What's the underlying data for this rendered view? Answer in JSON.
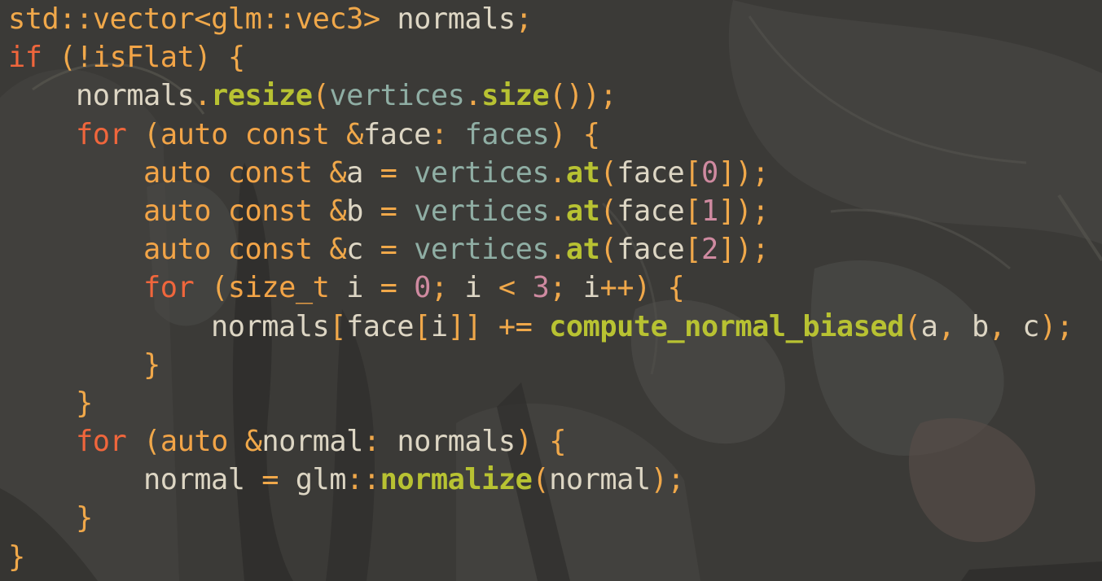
{
  "editor": {
    "language": "C++",
    "background_color": "#3b3a37",
    "theme": {
      "plain": "#ddd6c4",
      "punctuation": "#f0a84a",
      "keyword": "#f2a447",
      "control_flow": "#f0663c",
      "function": "#b8c232",
      "variable_dim": "#8faea4",
      "number": "#cf8aa0"
    }
  },
  "code": {
    "lines": [
      [
        [
          "ty",
          "std"
        ],
        [
          "pn",
          "::"
        ],
        [
          "ty",
          "vector"
        ],
        [
          "pn",
          "<"
        ],
        [
          "ty",
          "glm"
        ],
        [
          "pn",
          "::"
        ],
        [
          "ty",
          "vec3"
        ],
        [
          "pn",
          "> "
        ],
        [
          "pl",
          "normals"
        ],
        [
          "pn",
          ";"
        ]
      ],
      [
        [
          "cf",
          "if"
        ],
        [
          "pl",
          " "
        ],
        [
          "pn",
          "(!"
        ],
        [
          "kw",
          "isFlat"
        ],
        [
          "pn",
          ")"
        ],
        [
          "pl",
          " "
        ],
        [
          "pn",
          "{"
        ]
      ],
      [
        [
          "pl",
          "    normals"
        ],
        [
          "pn",
          "."
        ],
        [
          "fn",
          "resize"
        ],
        [
          "pn",
          "("
        ],
        [
          "vr",
          "vertices"
        ],
        [
          "pn",
          "."
        ],
        [
          "fn",
          "size"
        ],
        [
          "pn",
          "());"
        ]
      ],
      [
        [
          "pl",
          "    "
        ],
        [
          "cf",
          "for"
        ],
        [
          "pl",
          " "
        ],
        [
          "pn",
          "("
        ],
        [
          "kw",
          "auto"
        ],
        [
          "pl",
          " "
        ],
        [
          "kw",
          "const"
        ],
        [
          "pl",
          " "
        ],
        [
          "pn",
          "&"
        ],
        [
          "pl",
          "face"
        ],
        [
          "pn",
          ":"
        ],
        [
          "pl",
          " "
        ],
        [
          "vr",
          "faces"
        ],
        [
          "pn",
          ")"
        ],
        [
          "pl",
          " "
        ],
        [
          "pn",
          "{"
        ]
      ],
      [
        [
          "pl",
          "        "
        ],
        [
          "kw",
          "auto"
        ],
        [
          "pl",
          " "
        ],
        [
          "kw",
          "const"
        ],
        [
          "pl",
          " "
        ],
        [
          "pn",
          "&"
        ],
        [
          "pl",
          "a "
        ],
        [
          "op",
          "="
        ],
        [
          "pl",
          " "
        ],
        [
          "vr",
          "vertices"
        ],
        [
          "pn",
          "."
        ],
        [
          "fn",
          "at"
        ],
        [
          "pn",
          "("
        ],
        [
          "pl",
          "face"
        ],
        [
          "pn",
          "["
        ],
        [
          "nm",
          "0"
        ],
        [
          "pn",
          "]);"
        ]
      ],
      [
        [
          "pl",
          "        "
        ],
        [
          "kw",
          "auto"
        ],
        [
          "pl",
          " "
        ],
        [
          "kw",
          "const"
        ],
        [
          "pl",
          " "
        ],
        [
          "pn",
          "&"
        ],
        [
          "pl",
          "b "
        ],
        [
          "op",
          "="
        ],
        [
          "pl",
          " "
        ],
        [
          "vr",
          "vertices"
        ],
        [
          "pn",
          "."
        ],
        [
          "fn",
          "at"
        ],
        [
          "pn",
          "("
        ],
        [
          "pl",
          "face"
        ],
        [
          "pn",
          "["
        ],
        [
          "nm",
          "1"
        ],
        [
          "pn",
          "]);"
        ]
      ],
      [
        [
          "pl",
          "        "
        ],
        [
          "kw",
          "auto"
        ],
        [
          "pl",
          " "
        ],
        [
          "kw",
          "const"
        ],
        [
          "pl",
          " "
        ],
        [
          "pn",
          "&"
        ],
        [
          "pl",
          "c "
        ],
        [
          "op",
          "="
        ],
        [
          "pl",
          " "
        ],
        [
          "vr",
          "vertices"
        ],
        [
          "pn",
          "."
        ],
        [
          "fn",
          "at"
        ],
        [
          "pn",
          "("
        ],
        [
          "pl",
          "face"
        ],
        [
          "pn",
          "["
        ],
        [
          "nm",
          "2"
        ],
        [
          "pn",
          "]);"
        ]
      ],
      [
        [
          "pl",
          "        "
        ],
        [
          "cf",
          "for"
        ],
        [
          "pl",
          " "
        ],
        [
          "pn",
          "("
        ],
        [
          "kw",
          "size_t"
        ],
        [
          "pl",
          " i "
        ],
        [
          "op",
          "="
        ],
        [
          "pl",
          " "
        ],
        [
          "nm",
          "0"
        ],
        [
          "pn",
          ";"
        ],
        [
          "pl",
          " i "
        ],
        [
          "op",
          "<"
        ],
        [
          "pl",
          " "
        ],
        [
          "nm",
          "3"
        ],
        [
          "pn",
          ";"
        ],
        [
          "pl",
          " i"
        ],
        [
          "op",
          "++"
        ],
        [
          "pn",
          ")"
        ],
        [
          "pl",
          " "
        ],
        [
          "pn",
          "{"
        ]
      ],
      [
        [
          "pl",
          "            normals"
        ],
        [
          "pn",
          "["
        ],
        [
          "pl",
          "face"
        ],
        [
          "pn",
          "["
        ],
        [
          "pl",
          "i"
        ],
        [
          "pn",
          "]]"
        ],
        [
          "pl",
          " "
        ],
        [
          "op",
          "+="
        ],
        [
          "pl",
          " "
        ],
        [
          "fn",
          "compute_normal_biased"
        ],
        [
          "pn",
          "("
        ],
        [
          "pl",
          "a"
        ],
        [
          "pn",
          ","
        ],
        [
          "pl",
          " b"
        ],
        [
          "pn",
          ","
        ],
        [
          "pl",
          " c"
        ],
        [
          "pn",
          ");"
        ]
      ],
      [
        [
          "pl",
          "        "
        ],
        [
          "pn",
          "}"
        ]
      ],
      [
        [
          "pl",
          "    "
        ],
        [
          "pn",
          "}"
        ]
      ],
      [
        [
          "pl",
          "    "
        ],
        [
          "cf",
          "for"
        ],
        [
          "pl",
          " "
        ],
        [
          "pn",
          "("
        ],
        [
          "kw",
          "auto"
        ],
        [
          "pl",
          " "
        ],
        [
          "pn",
          "&"
        ],
        [
          "pl",
          "normal"
        ],
        [
          "pn",
          ":"
        ],
        [
          "pl",
          " normals"
        ],
        [
          "pn",
          ")"
        ],
        [
          "pl",
          " "
        ],
        [
          "pn",
          "{"
        ]
      ],
      [
        [
          "pl",
          "        normal "
        ],
        [
          "op",
          "="
        ],
        [
          "pl",
          " glm"
        ],
        [
          "ns",
          "::"
        ],
        [
          "fn",
          "normalize"
        ],
        [
          "pn",
          "("
        ],
        [
          "pl",
          "normal"
        ],
        [
          "pn",
          ");"
        ]
      ],
      [
        [
          "pl",
          "    "
        ],
        [
          "pn",
          "}"
        ]
      ],
      [
        [
          "pn",
          "}"
        ]
      ]
    ]
  }
}
